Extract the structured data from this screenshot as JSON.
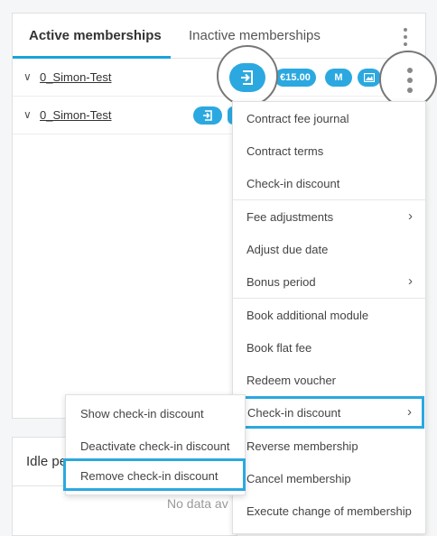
{
  "tabs": {
    "active": "Active memberships",
    "inactive": "Inactive memberships"
  },
  "rows": [
    {
      "name": "0_Simon-Test",
      "price": "€15.00",
      "badge": "M"
    },
    {
      "name": "0_Simon-Test"
    }
  ],
  "idle": {
    "title": "Idle pe",
    "empty": "No data av"
  },
  "menu": {
    "items": [
      "Contract fee journal",
      "Contract terms",
      "Check-in discount",
      "Fee adjustments",
      "Adjust due date",
      "Bonus period",
      "Book additional module",
      "Book flat fee",
      "Redeem voucher",
      "Check-in discount",
      "Reverse membership",
      "Cancel membership",
      "Execute change of membership"
    ]
  },
  "submenu": {
    "items": [
      "Show check-in discount",
      "Deactivate check-in discount",
      "Remove check-in discount"
    ]
  },
  "colors": {
    "accent": "#2ba8e0",
    "highlight_border": "#2ba8e0"
  }
}
